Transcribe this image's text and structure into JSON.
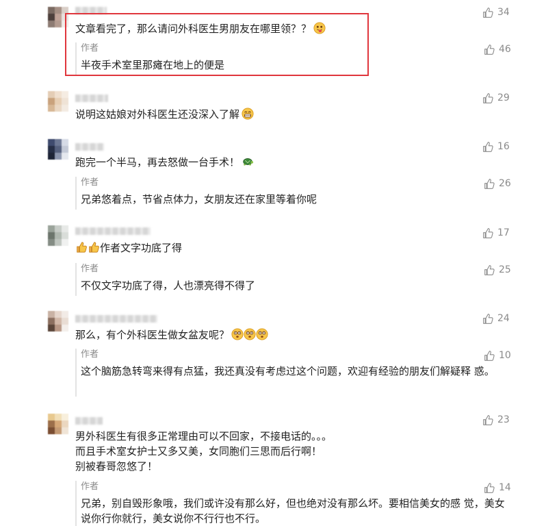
{
  "colors": {
    "highlight": "#e0353c",
    "like": "#8a8a8a",
    "text": "#222222"
  },
  "comments": [
    {
      "text": [
        "文章看完了，那么请问外科医生男朋友在哪里领？？"
      ],
      "likes": "34",
      "emoji": [
        "tongue-face"
      ],
      "reply": {
        "author": "作者",
        "text": [
          "半夜手术室里那瘫在地上的便是"
        ],
        "likes": "46"
      }
    },
    {
      "text": [
        "说明这姑娘对外科医生还没深入了解"
      ],
      "likes": "29",
      "emoji": [
        "grin-face"
      ]
    },
    {
      "text": [
        "跑完一个半马，再去怒做一台手术！"
      ],
      "likes": "16",
      "emoji": [
        "turtle"
      ],
      "reply": {
        "author": "作者",
        "text": [
          "兄弟悠着点，节省点体力，女朋友还在家里等着你呢"
        ],
        "likes": "26"
      }
    },
    {
      "text": [
        "作者文字功底了得"
      ],
      "likes": "17",
      "emoji_prefix": [
        "thumbs-up",
        "thumbs-up"
      ],
      "reply": {
        "author": "作者",
        "text": [
          "不仅文字功底了得，人也漂亮得不得了"
        ],
        "likes": "25"
      }
    },
    {
      "text": [
        "那么，有个外科医生做女盆友呢？"
      ],
      "likes": "24",
      "emoji": [
        "shocked-face",
        "shocked-face",
        "shocked-face"
      ],
      "reply": {
        "author": "作者",
        "text": [
          "这个脑筋急转弯来得有点猛，我还真没有考虑过这个问题，欢迎有经验的朋友们解疑释",
          "惑。"
        ],
        "likes": "10"
      }
    },
    {
      "text": [
        "男外科医生有很多正常理由可以不回家，不接电话的。。。",
        "而且手术室女护士又多又美，女同胞们三思而后行啊！",
        "别被春哥忽悠了！"
      ],
      "likes": "23",
      "reply": {
        "author": "作者",
        "text": [
          "兄弟，别自毁形象哦，我们或许没有那么好，但也绝对没有那么坏。要相信美女的感",
          "觉，美女说你行你就行，美女说你不行行也不行。"
        ],
        "likes": "14"
      }
    }
  ]
}
